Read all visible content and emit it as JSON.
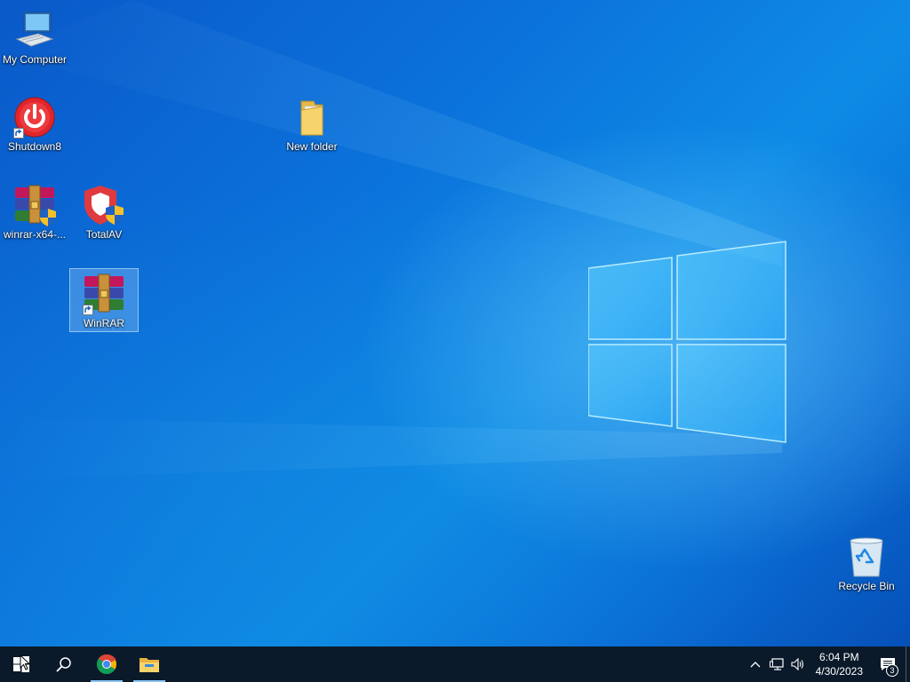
{
  "desktop": {
    "icons": [
      {
        "label": "My Computer",
        "icon": "computer-icon"
      },
      {
        "label": "Shutdown8",
        "icon": "power-icon"
      },
      {
        "label": "New folder",
        "icon": "folder-icon"
      },
      {
        "label": "winrar-x64-...",
        "icon": "winrar-installer-icon"
      },
      {
        "label": "TotalAV",
        "icon": "totalav-shield-icon"
      },
      {
        "label": "WinRAR",
        "icon": "winrar-icon"
      },
      {
        "label": "Recycle Bin",
        "icon": "recycle-bin-icon"
      }
    ]
  },
  "taskbar": {
    "start": "windows-start-icon",
    "search": "search-icon",
    "pinned": [
      "chrome-icon",
      "file-explorer-icon"
    ],
    "tray": [
      "chevron-up-icon",
      "network-icon",
      "volume-icon"
    ],
    "clock": {
      "time": "6:04 PM",
      "date": "4/30/2023"
    },
    "notifications": {
      "count": "3"
    }
  },
  "colors": {
    "taskbar": "#0b1a2a",
    "accent": "#0b72db",
    "selection": "#add8ff"
  }
}
